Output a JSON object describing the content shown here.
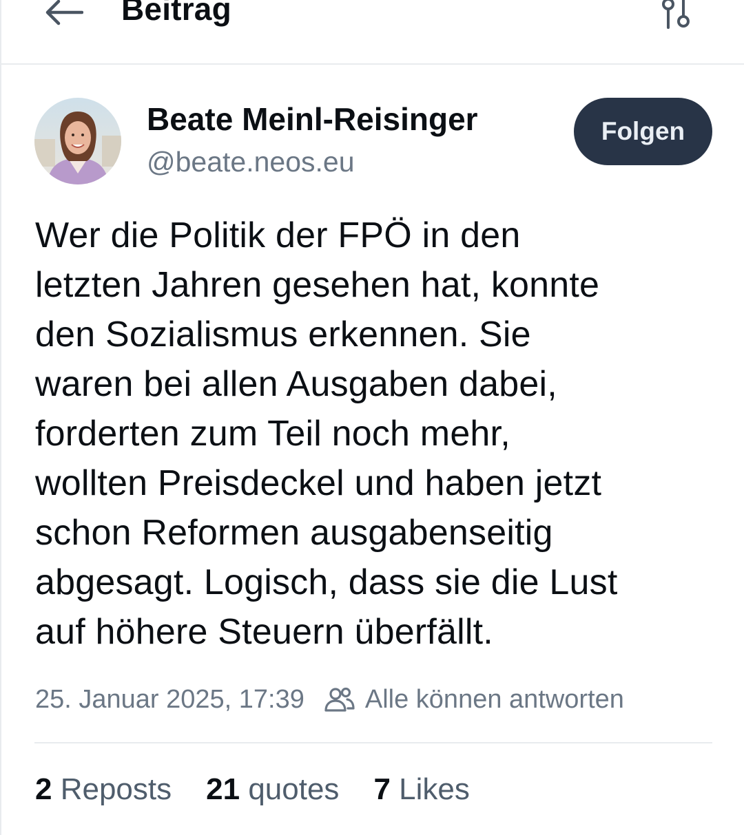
{
  "header": {
    "title": "Beitrag",
    "back_icon": "arrow-left-icon",
    "options_icon": "sliders-icon"
  },
  "author": {
    "name": "Beate Meinl-Reisinger",
    "handle": "@beate.neos.eu",
    "avatar_icon": "avatar-photo"
  },
  "follow_button": {
    "label": "Folgen",
    "bg_color": "#283447"
  },
  "post": {
    "text": "Wer die Politik der FPÖ in den\nletzten Jahren gesehen hat, konnte\nden Sozialismus erkennen. Sie\nwaren bei allen Ausgaben dabei,\nforderten zum Teil noch mehr,\nwollten Preisdeckel und haben jetzt\nschon Reformen ausgabenseitig\nabgesagt. Logisch, dass sie die Lust\nauf höhere Steuern überfällt.",
    "timestamp": "25. Januar 2025, 17:39",
    "reply_setting": "Alle können antworten",
    "reply_icon": "people-icon"
  },
  "stats": {
    "reposts": {
      "count": "2",
      "label": "Reposts"
    },
    "quotes": {
      "count": "21",
      "label": "quotes"
    },
    "likes": {
      "count": "7",
      "label": "Likes"
    }
  }
}
